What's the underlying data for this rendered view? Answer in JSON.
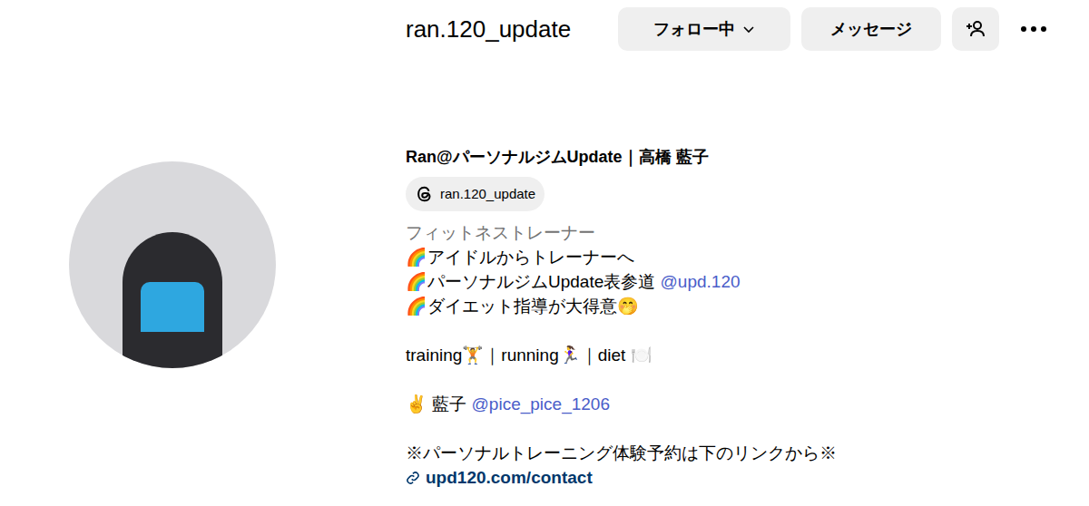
{
  "profile": {
    "username": "ran.120_update",
    "follow_button": "フォロー中",
    "message_button": "メッセージ",
    "name": "Ran@パーソナルジムUpdate｜高橋 藍子",
    "threads": "ran.120_update",
    "category": "フィットネストレーナー",
    "bio_lines": [
      {
        "segments": [
          {
            "text": "🌈アイドルからトレーナーへ",
            "kind": "plain"
          }
        ]
      },
      {
        "segments": [
          {
            "text": "🌈パーソナルジムUpdate表参道 ",
            "kind": "plain"
          },
          {
            "text": "@upd.120",
            "kind": "mention"
          }
        ]
      },
      {
        "segments": [
          {
            "text": "🌈ダイエット指導が大得意🤭",
            "kind": "plain"
          }
        ]
      },
      {
        "segments": []
      },
      {
        "segments": [
          {
            "text": "training🏋️｜running🏃‍♀️｜diet 🍽️",
            "kind": "plain"
          }
        ]
      },
      {
        "segments": []
      },
      {
        "segments": [
          {
            "text": "✌️ 藍子 ",
            "kind": "plain"
          },
          {
            "text": "@pice_pice_1206",
            "kind": "mention"
          }
        ]
      },
      {
        "segments": []
      },
      {
        "segments": [
          {
            "text": "※パーソナルトレーニング体験予約は下のリンクから※",
            "kind": "plain"
          }
        ]
      }
    ],
    "link": "upd120.com/contact"
  }
}
